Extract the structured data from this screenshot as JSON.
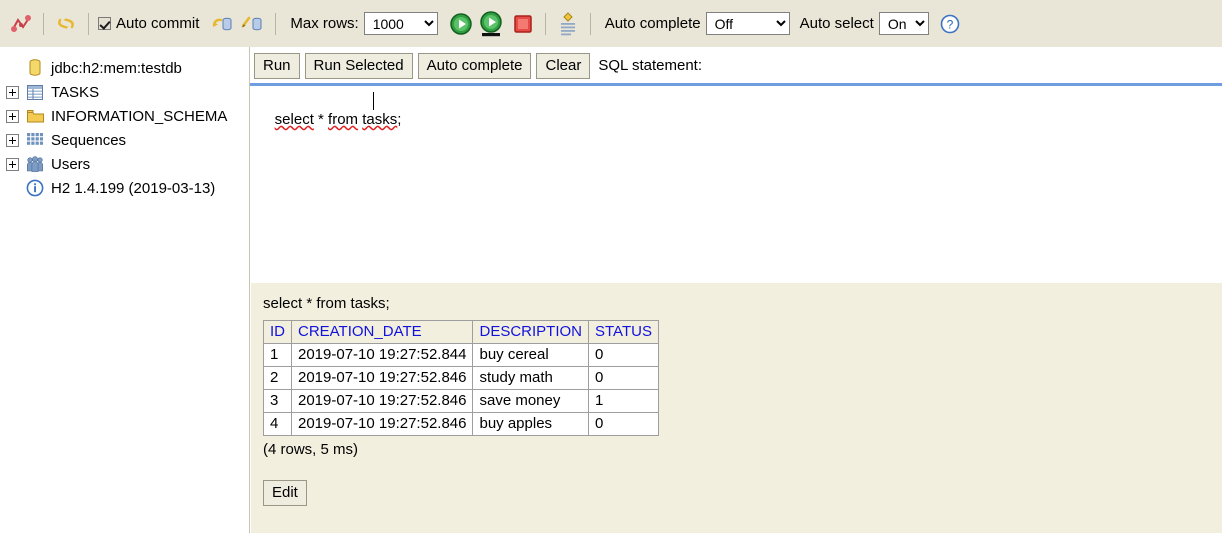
{
  "toolbar": {
    "icons": [
      {
        "name": "disconnect-icon",
        "title": "Disconnect"
      },
      {
        "name": "refresh-icon",
        "title": "Refresh"
      }
    ],
    "auto_commit_label": "Auto commit",
    "auto_commit_checked": true,
    "commit_icon_name": "commit-icon",
    "rollback_icon_name": "rollback-icon",
    "max_rows_label": "Max rows:",
    "max_rows_value": "1000",
    "max_rows_options": [
      "1000"
    ],
    "run_icon_name": "run-icon",
    "run_selected_icon_name": "run-selected-icon",
    "stop_icon_name": "stop-icon",
    "sql_history_icon_name": "sql-history-icon",
    "auto_complete_label": "Auto complete",
    "auto_complete_value": "Off",
    "auto_complete_options": [
      "Off"
    ],
    "auto_select_label": "Auto select",
    "auto_select_value": "On",
    "auto_select_options": [
      "On"
    ],
    "help_icon_name": "help-icon"
  },
  "tree": {
    "items": [
      {
        "label": "jdbc:h2:mem:testdb",
        "icon": "database-icon",
        "expandable": false
      },
      {
        "label": "TASKS",
        "icon": "table-icon",
        "expandable": true
      },
      {
        "label": "INFORMATION_SCHEMA",
        "icon": "folder-icon",
        "expandable": true
      },
      {
        "label": "Sequences",
        "icon": "sequences-icon",
        "expandable": true
      },
      {
        "label": "Users",
        "icon": "users-icon",
        "expandable": true
      },
      {
        "label": "H2 1.4.199 (2019-03-13)",
        "icon": "info-icon",
        "expandable": false
      }
    ]
  },
  "sql": {
    "buttons": {
      "run": "Run",
      "run_selected": "Run Selected",
      "auto_complete": "Auto complete",
      "clear": "Clear"
    },
    "statement_label": "SQL statement:",
    "text": "select * from tasks;",
    "tokens": [
      {
        "t": "select",
        "squiggle": true
      },
      {
        "t": " ",
        "squiggle": false
      },
      {
        "t": "*",
        "squiggle": false
      },
      {
        "t": " ",
        "squiggle": false
      },
      {
        "t": "from",
        "squiggle": true
      },
      {
        "t": " ",
        "squiggle": false
      },
      {
        "t": "tasks",
        "squiggle": true
      },
      {
        "t": ";",
        "squiggle": false
      }
    ]
  },
  "result": {
    "query_echo": "select * from tasks;",
    "columns": [
      "ID",
      "CREATION_DATE",
      "DESCRIPTION",
      "STATUS"
    ],
    "rows": [
      [
        "1",
        "2019-07-10 19:27:52.844",
        "buy cereal",
        "0"
      ],
      [
        "2",
        "2019-07-10 19:27:52.846",
        "study math",
        "0"
      ],
      [
        "3",
        "2019-07-10 19:27:52.846",
        "save money",
        "1"
      ],
      [
        "4",
        "2019-07-10 19:27:52.846",
        "buy apples",
        "0"
      ]
    ],
    "status": "(4 rows, 5 ms)",
    "edit_label": "Edit"
  },
  "colors": {
    "toolbar_bg": "#E9E6D7",
    "result_bg": "#F2EFDF",
    "accent_blue": "#6F9DE0",
    "header_text": "#1212DD",
    "run_green": "#1B8F2E",
    "stop_red": "#E23A35"
  }
}
